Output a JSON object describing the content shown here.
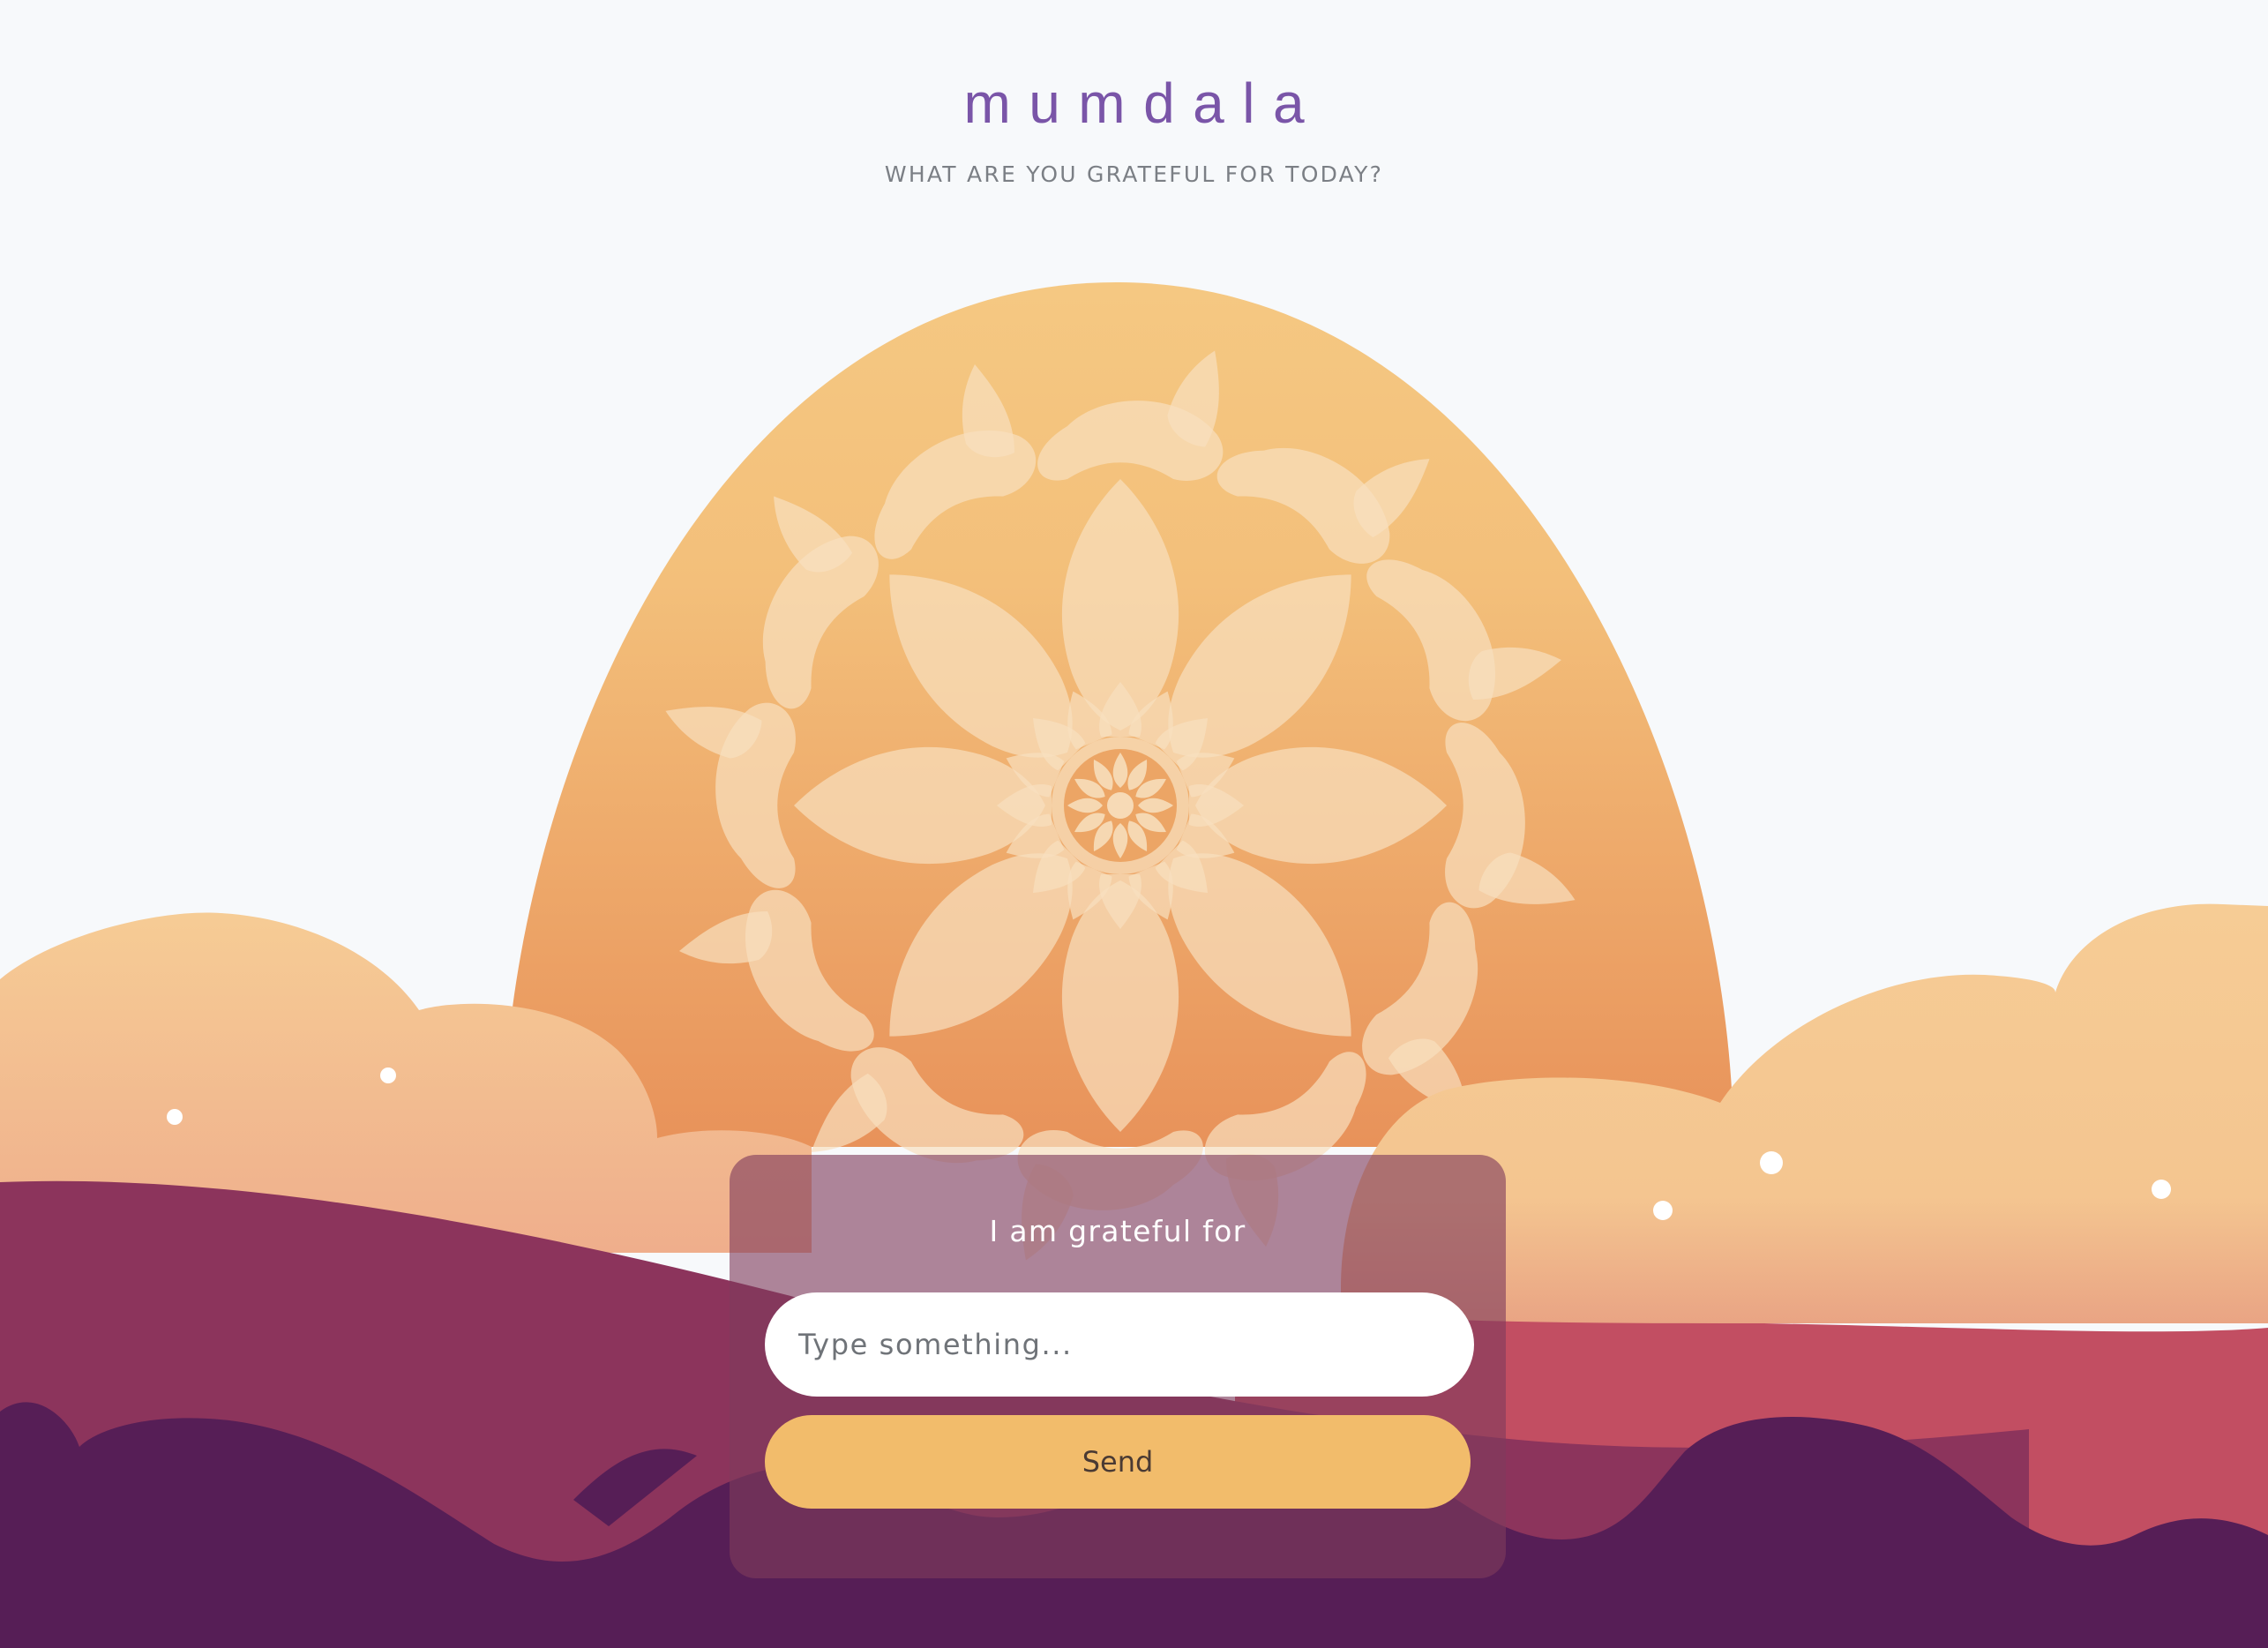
{
  "app": {
    "brand": "mumdala",
    "tagline": "WHAT ARE YOU GRATEFUL FOR TODAY?"
  },
  "form": {
    "title": "I am grateful for",
    "input_placeholder": "Type something...",
    "input_value": "",
    "send_label": "Send"
  },
  "illustration": {
    "sun_top_color": "#f5c882",
    "sun_bottom_color": "#e9975a",
    "cloud_color": "#f5c994",
    "hill_color": "#8c345c",
    "hill_right_color": "#c24e62",
    "foreground_color": "#561e56",
    "mandala_color": "#f8e0bf"
  },
  "colors": {
    "brand": "#7a55a8",
    "send_button": "#f2bc6b",
    "background": "#f7f9fb"
  }
}
